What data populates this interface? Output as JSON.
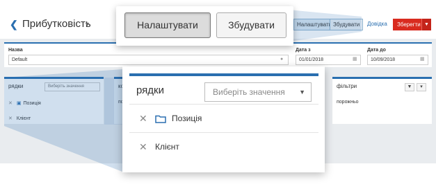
{
  "header": {
    "title": "Прибутковість",
    "back_icon": "chevron-left-icon",
    "title_caret_icon": "caret-down-icon",
    "configure_small": "Налаштувати",
    "build_small": "Збудувати",
    "help": "Довідка",
    "save": "Зберегти"
  },
  "form": {
    "name_label": "Назва",
    "name_value": "Default",
    "date_from_label": "Дата з",
    "date_from_value": "01/01/2018",
    "date_to_label": "Дата до",
    "date_to_value": "10/09/2018"
  },
  "cards": {
    "rows_title": "рядки",
    "rows_select_placeholder": "Виберіть значення",
    "columns_title_fragment": "ко",
    "columns_body_fragment": "по",
    "filters_title": "фільтри",
    "filters_empty": "порожньо",
    "rows": [
      {
        "label": "Позиція",
        "icon": "folder-icon"
      },
      {
        "label": "Клієнт"
      }
    ]
  },
  "zoom_buttons": {
    "configure": "Налаштувати",
    "build": "Збудувати"
  },
  "zoom_rows": {
    "title": "рядки",
    "select_placeholder": "Виберіть значення",
    "items": [
      {
        "label": "Позиція",
        "icon": "folder-icon",
        "remove_icon": "close-icon"
      },
      {
        "label": "Клієнт",
        "remove_icon": "close-icon"
      }
    ]
  },
  "colors": {
    "accent": "#2a6fb0",
    "save": "#d92b1f",
    "background": "#e9ecef"
  }
}
